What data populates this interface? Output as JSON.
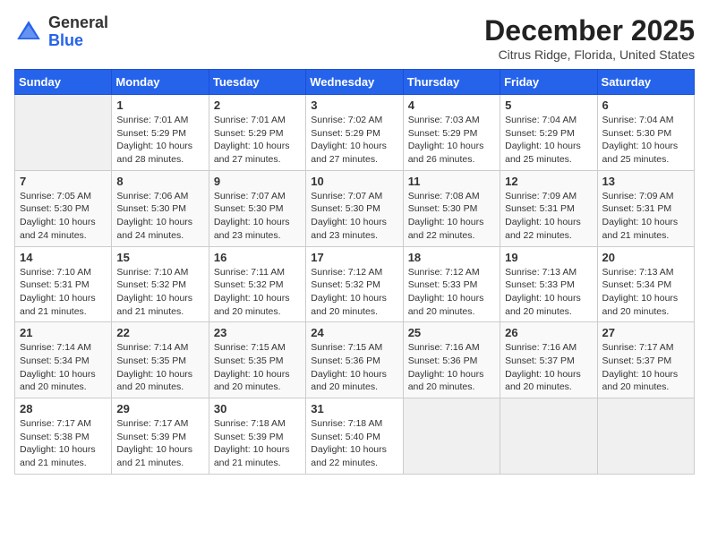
{
  "header": {
    "logo_line1": "General",
    "logo_line2": "Blue",
    "month_title": "December 2025",
    "location": "Citrus Ridge, Florida, United States"
  },
  "days_of_week": [
    "Sunday",
    "Monday",
    "Tuesday",
    "Wednesday",
    "Thursday",
    "Friday",
    "Saturday"
  ],
  "weeks": [
    [
      {
        "day": "",
        "sunrise": "",
        "sunset": "",
        "daylight": ""
      },
      {
        "day": "1",
        "sunrise": "Sunrise: 7:01 AM",
        "sunset": "Sunset: 5:29 PM",
        "daylight": "Daylight: 10 hours and 28 minutes."
      },
      {
        "day": "2",
        "sunrise": "Sunrise: 7:01 AM",
        "sunset": "Sunset: 5:29 PM",
        "daylight": "Daylight: 10 hours and 27 minutes."
      },
      {
        "day": "3",
        "sunrise": "Sunrise: 7:02 AM",
        "sunset": "Sunset: 5:29 PM",
        "daylight": "Daylight: 10 hours and 27 minutes."
      },
      {
        "day": "4",
        "sunrise": "Sunrise: 7:03 AM",
        "sunset": "Sunset: 5:29 PM",
        "daylight": "Daylight: 10 hours and 26 minutes."
      },
      {
        "day": "5",
        "sunrise": "Sunrise: 7:04 AM",
        "sunset": "Sunset: 5:29 PM",
        "daylight": "Daylight: 10 hours and 25 minutes."
      },
      {
        "day": "6",
        "sunrise": "Sunrise: 7:04 AM",
        "sunset": "Sunset: 5:30 PM",
        "daylight": "Daylight: 10 hours and 25 minutes."
      }
    ],
    [
      {
        "day": "7",
        "sunrise": "Sunrise: 7:05 AM",
        "sunset": "Sunset: 5:30 PM",
        "daylight": "Daylight: 10 hours and 24 minutes."
      },
      {
        "day": "8",
        "sunrise": "Sunrise: 7:06 AM",
        "sunset": "Sunset: 5:30 PM",
        "daylight": "Daylight: 10 hours and 24 minutes."
      },
      {
        "day": "9",
        "sunrise": "Sunrise: 7:07 AM",
        "sunset": "Sunset: 5:30 PM",
        "daylight": "Daylight: 10 hours and 23 minutes."
      },
      {
        "day": "10",
        "sunrise": "Sunrise: 7:07 AM",
        "sunset": "Sunset: 5:30 PM",
        "daylight": "Daylight: 10 hours and 23 minutes."
      },
      {
        "day": "11",
        "sunrise": "Sunrise: 7:08 AM",
        "sunset": "Sunset: 5:30 PM",
        "daylight": "Daylight: 10 hours and 22 minutes."
      },
      {
        "day": "12",
        "sunrise": "Sunrise: 7:09 AM",
        "sunset": "Sunset: 5:31 PM",
        "daylight": "Daylight: 10 hours and 22 minutes."
      },
      {
        "day": "13",
        "sunrise": "Sunrise: 7:09 AM",
        "sunset": "Sunset: 5:31 PM",
        "daylight": "Daylight: 10 hours and 21 minutes."
      }
    ],
    [
      {
        "day": "14",
        "sunrise": "Sunrise: 7:10 AM",
        "sunset": "Sunset: 5:31 PM",
        "daylight": "Daylight: 10 hours and 21 minutes."
      },
      {
        "day": "15",
        "sunrise": "Sunrise: 7:10 AM",
        "sunset": "Sunset: 5:32 PM",
        "daylight": "Daylight: 10 hours and 21 minutes."
      },
      {
        "day": "16",
        "sunrise": "Sunrise: 7:11 AM",
        "sunset": "Sunset: 5:32 PM",
        "daylight": "Daylight: 10 hours and 20 minutes."
      },
      {
        "day": "17",
        "sunrise": "Sunrise: 7:12 AM",
        "sunset": "Sunset: 5:32 PM",
        "daylight": "Daylight: 10 hours and 20 minutes."
      },
      {
        "day": "18",
        "sunrise": "Sunrise: 7:12 AM",
        "sunset": "Sunset: 5:33 PM",
        "daylight": "Daylight: 10 hours and 20 minutes."
      },
      {
        "day": "19",
        "sunrise": "Sunrise: 7:13 AM",
        "sunset": "Sunset: 5:33 PM",
        "daylight": "Daylight: 10 hours and 20 minutes."
      },
      {
        "day": "20",
        "sunrise": "Sunrise: 7:13 AM",
        "sunset": "Sunset: 5:34 PM",
        "daylight": "Daylight: 10 hours and 20 minutes."
      }
    ],
    [
      {
        "day": "21",
        "sunrise": "Sunrise: 7:14 AM",
        "sunset": "Sunset: 5:34 PM",
        "daylight": "Daylight: 10 hours and 20 minutes."
      },
      {
        "day": "22",
        "sunrise": "Sunrise: 7:14 AM",
        "sunset": "Sunset: 5:35 PM",
        "daylight": "Daylight: 10 hours and 20 minutes."
      },
      {
        "day": "23",
        "sunrise": "Sunrise: 7:15 AM",
        "sunset": "Sunset: 5:35 PM",
        "daylight": "Daylight: 10 hours and 20 minutes."
      },
      {
        "day": "24",
        "sunrise": "Sunrise: 7:15 AM",
        "sunset": "Sunset: 5:36 PM",
        "daylight": "Daylight: 10 hours and 20 minutes."
      },
      {
        "day": "25",
        "sunrise": "Sunrise: 7:16 AM",
        "sunset": "Sunset: 5:36 PM",
        "daylight": "Daylight: 10 hours and 20 minutes."
      },
      {
        "day": "26",
        "sunrise": "Sunrise: 7:16 AM",
        "sunset": "Sunset: 5:37 PM",
        "daylight": "Daylight: 10 hours and 20 minutes."
      },
      {
        "day": "27",
        "sunrise": "Sunrise: 7:17 AM",
        "sunset": "Sunset: 5:37 PM",
        "daylight": "Daylight: 10 hours and 20 minutes."
      }
    ],
    [
      {
        "day": "28",
        "sunrise": "Sunrise: 7:17 AM",
        "sunset": "Sunset: 5:38 PM",
        "daylight": "Daylight: 10 hours and 21 minutes."
      },
      {
        "day": "29",
        "sunrise": "Sunrise: 7:17 AM",
        "sunset": "Sunset: 5:39 PM",
        "daylight": "Daylight: 10 hours and 21 minutes."
      },
      {
        "day": "30",
        "sunrise": "Sunrise: 7:18 AM",
        "sunset": "Sunset: 5:39 PM",
        "daylight": "Daylight: 10 hours and 21 minutes."
      },
      {
        "day": "31",
        "sunrise": "Sunrise: 7:18 AM",
        "sunset": "Sunset: 5:40 PM",
        "daylight": "Daylight: 10 hours and 22 minutes."
      },
      {
        "day": "",
        "sunrise": "",
        "sunset": "",
        "daylight": ""
      },
      {
        "day": "",
        "sunrise": "",
        "sunset": "",
        "daylight": ""
      },
      {
        "day": "",
        "sunrise": "",
        "sunset": "",
        "daylight": ""
      }
    ]
  ]
}
